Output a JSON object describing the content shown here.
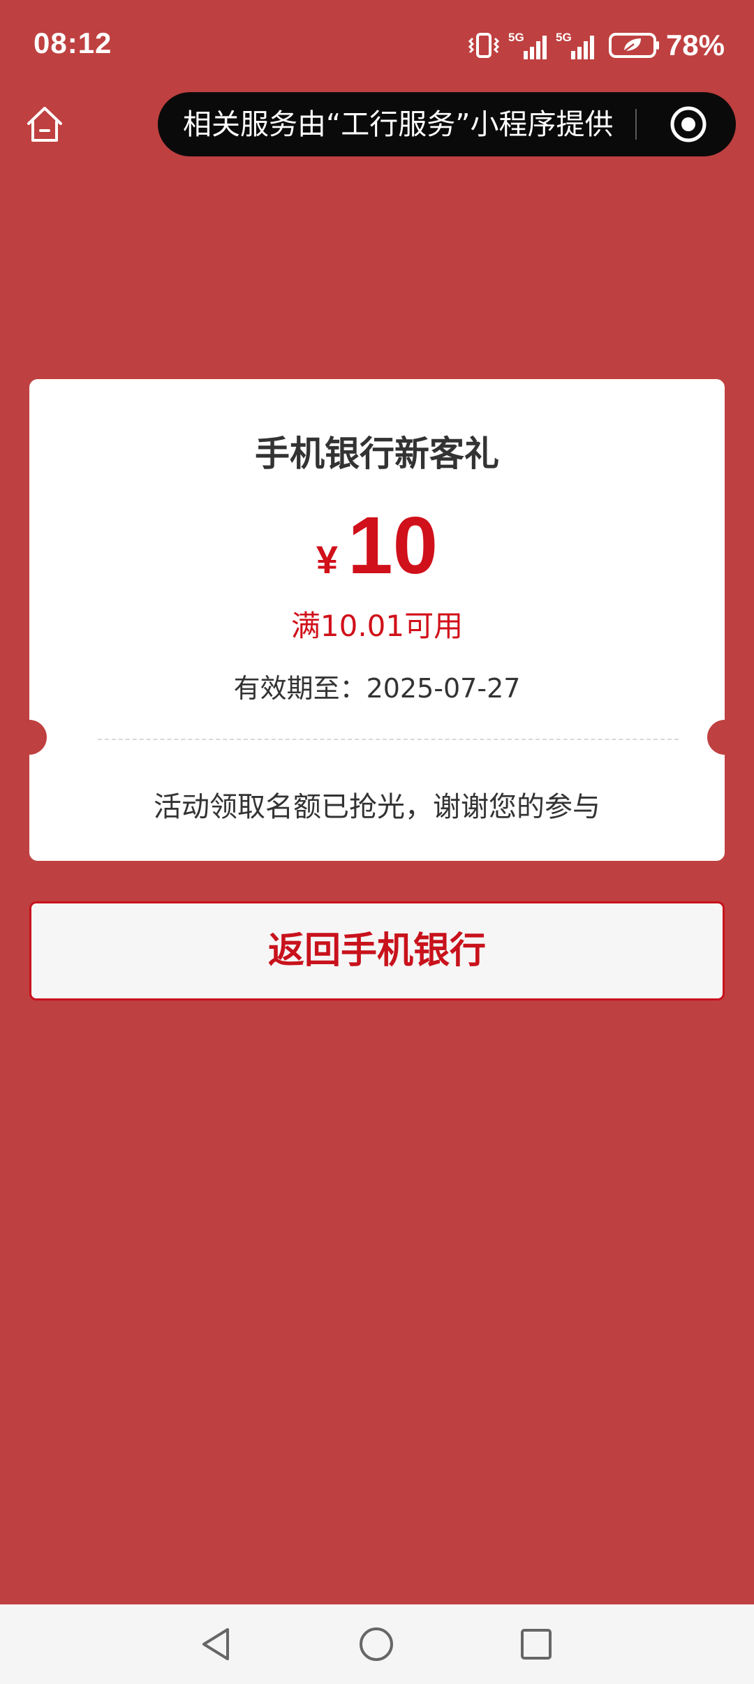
{
  "status_bar": {
    "time": "08:12",
    "battery": "78%",
    "icons": [
      "vibrate-icon",
      "signal-5g-icon",
      "signal-5g-icon",
      "battery-saver-icon"
    ]
  },
  "nav": {
    "home_icon": "home-icon",
    "capsule_text": "相关服务由“工行服务”小程序提供",
    "close_icon": "target-close-icon"
  },
  "coupon": {
    "title": "手机银行新客礼",
    "currency": "¥",
    "amount": "10",
    "threshold": "满10.01可用",
    "validity": "有效期至：2025-07-27",
    "status_message": "活动领取名额已抢光，谢谢您的参与"
  },
  "actions": {
    "return_label": "返回手机银行"
  },
  "system_nav": {
    "back_icon": "back-triangle-icon",
    "home_icon": "home-circle-icon",
    "recent_icon": "recent-square-icon"
  },
  "colors": {
    "background": "#bf4040",
    "accent_red": "#d0101a",
    "card": "#ffffff",
    "capsule": "#0a0a0a"
  }
}
